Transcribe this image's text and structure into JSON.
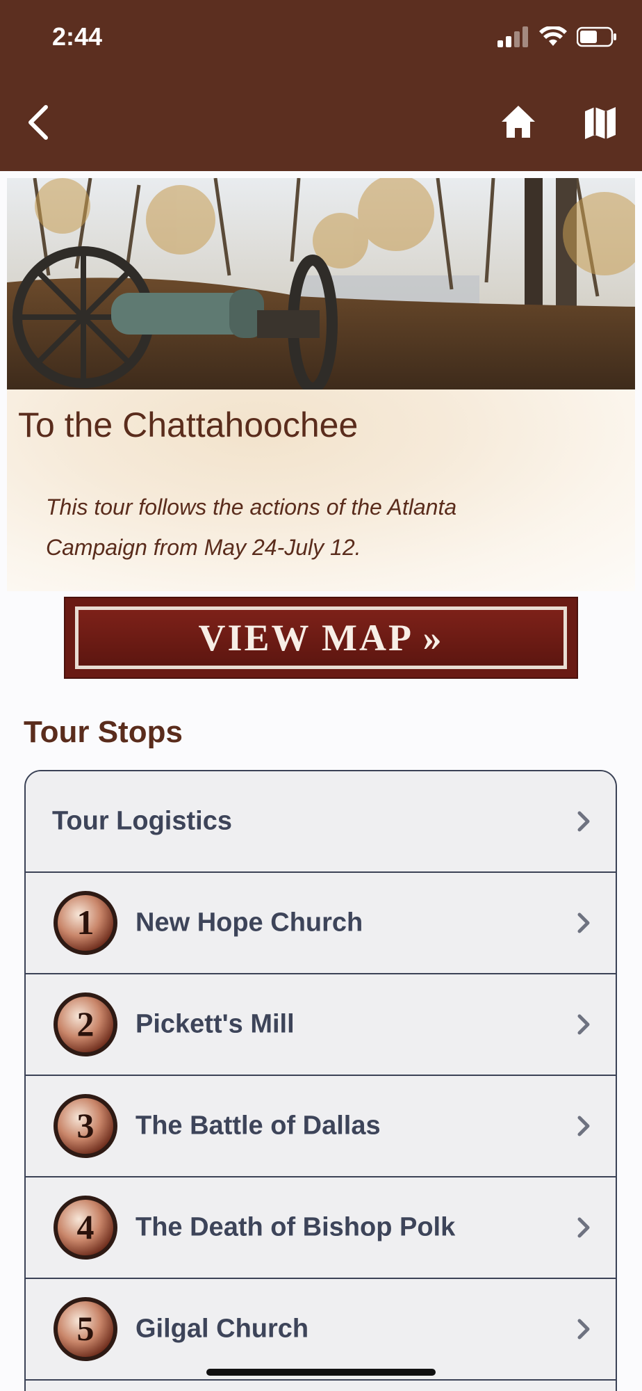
{
  "status_bar": {
    "time": "2:44"
  },
  "header": {
    "icons": {
      "back": "chevron-left-icon",
      "home": "home-icon",
      "map": "map-icon"
    },
    "colors": {
      "background": "#5c2f20"
    }
  },
  "hero": {
    "image": "cannon-on-hilltop-photo"
  },
  "tour": {
    "title": "To the Chattahoochee",
    "description": "This tour follows the actions of the Atlanta Campaign from May 24-July 12."
  },
  "view_map_button": {
    "label": "VIEW MAP »"
  },
  "tour_stops": {
    "heading": "Tour Stops",
    "items": [
      {
        "label": "Tour Logistics"
      },
      {
        "number": "1",
        "label": "New Hope Church"
      },
      {
        "number": "2",
        "label": "Pickett's Mill"
      },
      {
        "number": "3",
        "label": "The Battle of Dallas"
      },
      {
        "number": "4",
        "label": "The Death of Bishop Polk"
      },
      {
        "number": "5",
        "label": "Gilgal Church"
      }
    ]
  },
  "colors": {
    "accent": "#5a2c1c",
    "button": "#6a1b14",
    "list_text": "#3d4459",
    "list_bg": "#efeff1"
  }
}
